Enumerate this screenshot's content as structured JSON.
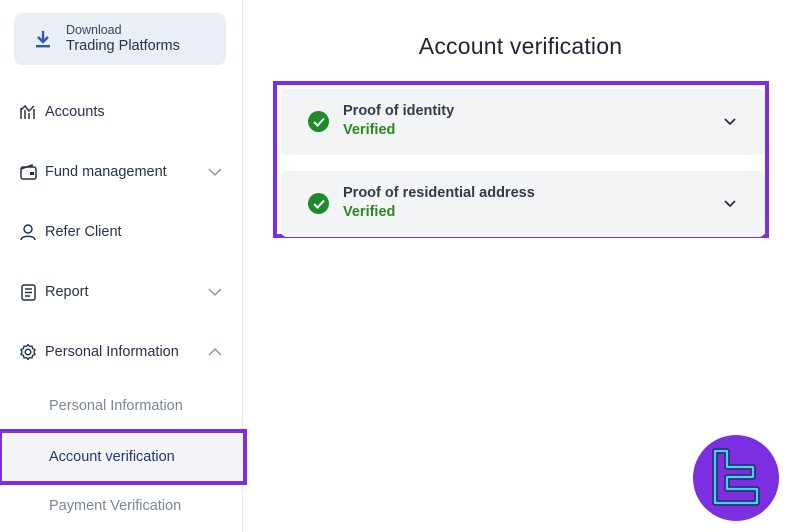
{
  "sidebar": {
    "download": {
      "small_label": "Download",
      "big_label": "Trading Platforms",
      "icon": "download-icon"
    },
    "items": [
      {
        "label": "Accounts",
        "icon": "chart-icon"
      },
      {
        "label": "Fund management",
        "icon": "wallet-icon",
        "chevron": "chevron-down-icon"
      },
      {
        "label": "Refer Client",
        "icon": "user-icon"
      },
      {
        "label": "Report",
        "icon": "document-icon",
        "chevron": "chevron-down-icon"
      },
      {
        "label": "Personal Information",
        "icon": "gear-icon",
        "chevron": "chevron-up-icon"
      }
    ],
    "sub_items": [
      {
        "label": "Personal Information",
        "active": false
      },
      {
        "label": "Account verification",
        "active": true
      },
      {
        "label": "Payment Verification",
        "active": false
      }
    ]
  },
  "main": {
    "title": "Account verification",
    "rows": [
      {
        "title": "Proof of identity",
        "status": "Verified",
        "icon": "check-circle-icon"
      },
      {
        "title": "Proof of residential address",
        "status": "Verified",
        "icon": "check-circle-icon"
      }
    ]
  },
  "colors": {
    "highlight": "#7b2fe0",
    "verified": "#2a8a20",
    "check_bg": "#1f8a2b",
    "download_bg": "#e9eef7"
  },
  "watermark": {
    "icon": "tradingfinder-logo-icon"
  }
}
